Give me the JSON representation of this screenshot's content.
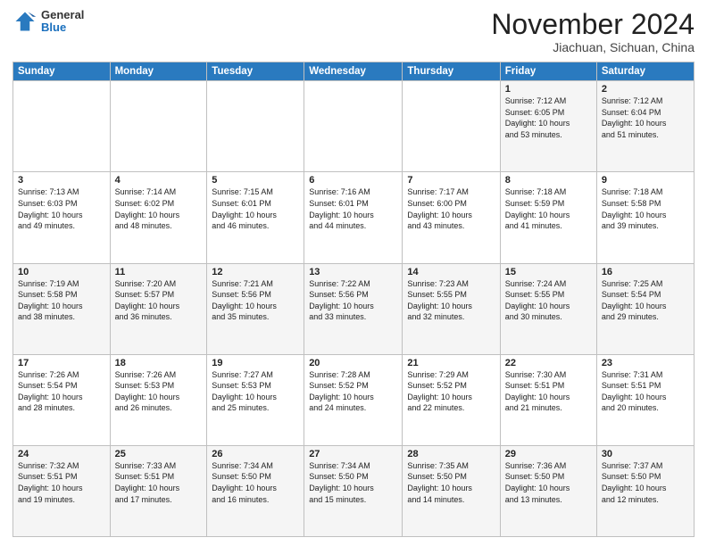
{
  "header": {
    "logo_general": "General",
    "logo_blue": "Blue",
    "month_title": "November 2024",
    "location": "Jiachuan, Sichuan, China"
  },
  "days_of_week": [
    "Sunday",
    "Monday",
    "Tuesday",
    "Wednesday",
    "Thursday",
    "Friday",
    "Saturday"
  ],
  "weeks": [
    [
      {
        "day": "",
        "info": ""
      },
      {
        "day": "",
        "info": ""
      },
      {
        "day": "",
        "info": ""
      },
      {
        "day": "",
        "info": ""
      },
      {
        "day": "",
        "info": ""
      },
      {
        "day": "1",
        "info": "Sunrise: 7:12 AM\nSunset: 6:05 PM\nDaylight: 10 hours\nand 53 minutes."
      },
      {
        "day": "2",
        "info": "Sunrise: 7:12 AM\nSunset: 6:04 PM\nDaylight: 10 hours\nand 51 minutes."
      }
    ],
    [
      {
        "day": "3",
        "info": "Sunrise: 7:13 AM\nSunset: 6:03 PM\nDaylight: 10 hours\nand 49 minutes."
      },
      {
        "day": "4",
        "info": "Sunrise: 7:14 AM\nSunset: 6:02 PM\nDaylight: 10 hours\nand 48 minutes."
      },
      {
        "day": "5",
        "info": "Sunrise: 7:15 AM\nSunset: 6:01 PM\nDaylight: 10 hours\nand 46 minutes."
      },
      {
        "day": "6",
        "info": "Sunrise: 7:16 AM\nSunset: 6:01 PM\nDaylight: 10 hours\nand 44 minutes."
      },
      {
        "day": "7",
        "info": "Sunrise: 7:17 AM\nSunset: 6:00 PM\nDaylight: 10 hours\nand 43 minutes."
      },
      {
        "day": "8",
        "info": "Sunrise: 7:18 AM\nSunset: 5:59 PM\nDaylight: 10 hours\nand 41 minutes."
      },
      {
        "day": "9",
        "info": "Sunrise: 7:18 AM\nSunset: 5:58 PM\nDaylight: 10 hours\nand 39 minutes."
      }
    ],
    [
      {
        "day": "10",
        "info": "Sunrise: 7:19 AM\nSunset: 5:58 PM\nDaylight: 10 hours\nand 38 minutes."
      },
      {
        "day": "11",
        "info": "Sunrise: 7:20 AM\nSunset: 5:57 PM\nDaylight: 10 hours\nand 36 minutes."
      },
      {
        "day": "12",
        "info": "Sunrise: 7:21 AM\nSunset: 5:56 PM\nDaylight: 10 hours\nand 35 minutes."
      },
      {
        "day": "13",
        "info": "Sunrise: 7:22 AM\nSunset: 5:56 PM\nDaylight: 10 hours\nand 33 minutes."
      },
      {
        "day": "14",
        "info": "Sunrise: 7:23 AM\nSunset: 5:55 PM\nDaylight: 10 hours\nand 32 minutes."
      },
      {
        "day": "15",
        "info": "Sunrise: 7:24 AM\nSunset: 5:55 PM\nDaylight: 10 hours\nand 30 minutes."
      },
      {
        "day": "16",
        "info": "Sunrise: 7:25 AM\nSunset: 5:54 PM\nDaylight: 10 hours\nand 29 minutes."
      }
    ],
    [
      {
        "day": "17",
        "info": "Sunrise: 7:26 AM\nSunset: 5:54 PM\nDaylight: 10 hours\nand 28 minutes."
      },
      {
        "day": "18",
        "info": "Sunrise: 7:26 AM\nSunset: 5:53 PM\nDaylight: 10 hours\nand 26 minutes."
      },
      {
        "day": "19",
        "info": "Sunrise: 7:27 AM\nSunset: 5:53 PM\nDaylight: 10 hours\nand 25 minutes."
      },
      {
        "day": "20",
        "info": "Sunrise: 7:28 AM\nSunset: 5:52 PM\nDaylight: 10 hours\nand 24 minutes."
      },
      {
        "day": "21",
        "info": "Sunrise: 7:29 AM\nSunset: 5:52 PM\nDaylight: 10 hours\nand 22 minutes."
      },
      {
        "day": "22",
        "info": "Sunrise: 7:30 AM\nSunset: 5:51 PM\nDaylight: 10 hours\nand 21 minutes."
      },
      {
        "day": "23",
        "info": "Sunrise: 7:31 AM\nSunset: 5:51 PM\nDaylight: 10 hours\nand 20 minutes."
      }
    ],
    [
      {
        "day": "24",
        "info": "Sunrise: 7:32 AM\nSunset: 5:51 PM\nDaylight: 10 hours\nand 19 minutes."
      },
      {
        "day": "25",
        "info": "Sunrise: 7:33 AM\nSunset: 5:51 PM\nDaylight: 10 hours\nand 17 minutes."
      },
      {
        "day": "26",
        "info": "Sunrise: 7:34 AM\nSunset: 5:50 PM\nDaylight: 10 hours\nand 16 minutes."
      },
      {
        "day": "27",
        "info": "Sunrise: 7:34 AM\nSunset: 5:50 PM\nDaylight: 10 hours\nand 15 minutes."
      },
      {
        "day": "28",
        "info": "Sunrise: 7:35 AM\nSunset: 5:50 PM\nDaylight: 10 hours\nand 14 minutes."
      },
      {
        "day": "29",
        "info": "Sunrise: 7:36 AM\nSunset: 5:50 PM\nDaylight: 10 hours\nand 13 minutes."
      },
      {
        "day": "30",
        "info": "Sunrise: 7:37 AM\nSunset: 5:50 PM\nDaylight: 10 hours\nand 12 minutes."
      }
    ]
  ]
}
